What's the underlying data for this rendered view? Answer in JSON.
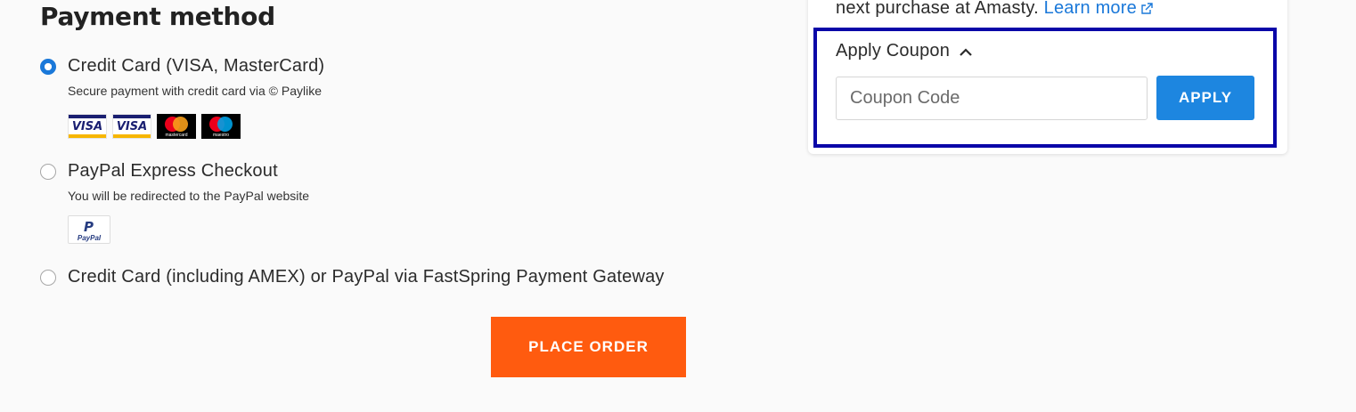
{
  "payment": {
    "title": "Payment method",
    "options": [
      {
        "label": "Credit Card (VISA, MasterCard)",
        "description": "Secure payment with credit card via © Paylike",
        "selected": true,
        "cards": [
          "visa",
          "visa-electron",
          "mastercard",
          "maestro"
        ]
      },
      {
        "label": "PayPal Express Checkout",
        "description": "You will be redirected to the PayPal website",
        "selected": false
      },
      {
        "label": "Credit Card (including AMEX) or PayPal via FastSpring Payment Gateway",
        "selected": false
      }
    ],
    "card_logos": {
      "visa": "VISA",
      "mastercard": "mastercard",
      "maestro": "maestro",
      "paypal": "PayPal"
    },
    "place_order_label": "PLACE ORDER"
  },
  "sidebar": {
    "promo_text": "next purchase at Amasty.",
    "learn_more_label": "Learn more",
    "coupon": {
      "toggle_label": "Apply Coupon",
      "expanded": true,
      "input_placeholder": "Coupon Code",
      "input_value": "",
      "apply_label": "APPLY"
    }
  },
  "colors": {
    "accent_orange": "#ff5b0f",
    "accent_blue": "#1d86e0",
    "highlight_border": "#0a06a8"
  }
}
